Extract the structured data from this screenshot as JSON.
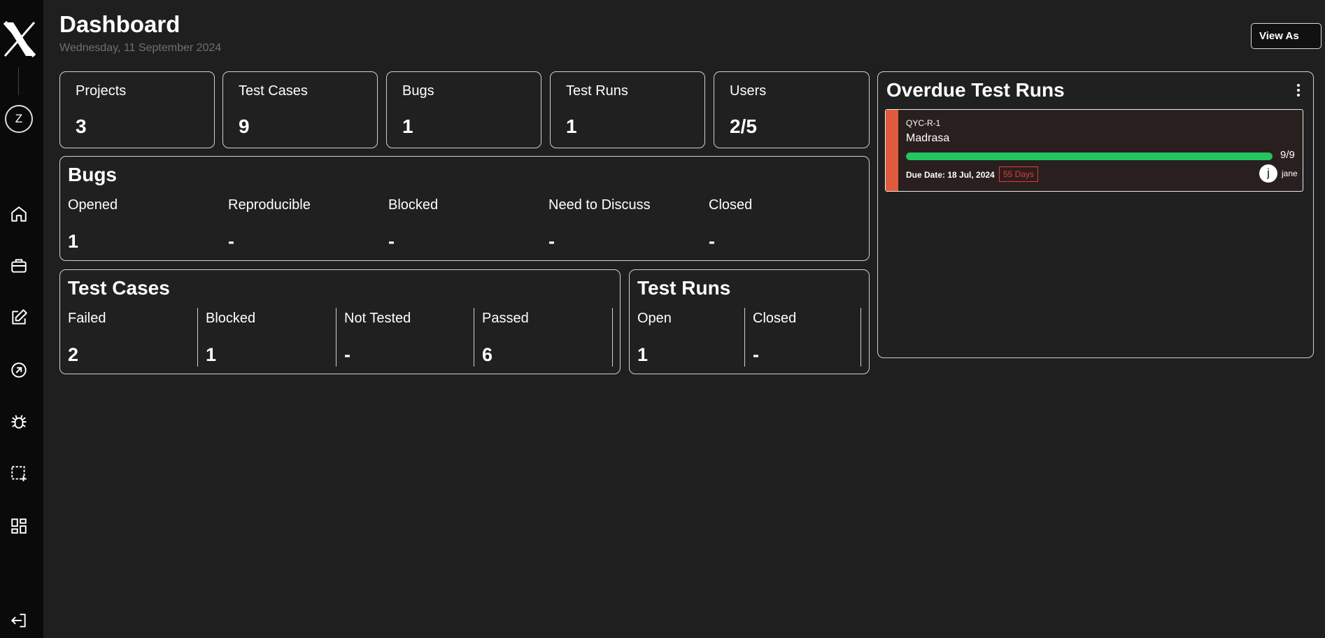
{
  "header": {
    "title": "Dashboard",
    "date": "Wednesday, 11 September 2024",
    "view_as_label": "View As"
  },
  "sidebar": {
    "avatar_initial": "Z",
    "icons": [
      "home-icon",
      "briefcase-icon",
      "edit-icon",
      "arrow-up-right-circle-icon",
      "bug-icon",
      "add-selection-icon",
      "dashboard-grid-icon",
      "logout-icon"
    ]
  },
  "stats": [
    {
      "label": "Projects",
      "value": "3"
    },
    {
      "label": "Test Cases",
      "value": "9"
    },
    {
      "label": "Bugs",
      "value": "1"
    },
    {
      "label": "Test Runs",
      "value": "1"
    },
    {
      "label": "Users",
      "value": "2/5"
    }
  ],
  "bugs": {
    "title": "Bugs",
    "columns": [
      {
        "label": "Opened",
        "value": "1"
      },
      {
        "label": "Reproducible",
        "value": "-"
      },
      {
        "label": "Blocked",
        "value": "-"
      },
      {
        "label": "Need to Discuss",
        "value": "-"
      },
      {
        "label": "Closed",
        "value": "-"
      }
    ]
  },
  "test_cases": {
    "title": "Test Cases",
    "columns": [
      {
        "label": "Failed",
        "value": "2"
      },
      {
        "label": "Blocked",
        "value": "1"
      },
      {
        "label": "Not Tested",
        "value": "-"
      },
      {
        "label": "Passed",
        "value": "6"
      }
    ]
  },
  "test_runs": {
    "title": "Test Runs",
    "columns": [
      {
        "label": "Open",
        "value": "1"
      },
      {
        "label": "Closed",
        "value": "-"
      }
    ]
  },
  "overdue": {
    "title": "Overdue Test Runs",
    "items": [
      {
        "code": "QYC-R-1",
        "name": "Madrasa",
        "progress_text": "9/9",
        "progress_fraction": 1.0,
        "due_date": "Due Date: 18 Jul, 2024",
        "overdue_badge": "55 Days",
        "assignee_initial": "j",
        "assignee_name": "jane"
      }
    ]
  },
  "colors": {
    "background": "#1f1f1f",
    "sidebar": "#0a0a0a",
    "progress": "#22c55e",
    "overdue_stripe": "#e05a3c",
    "overdue_badge": "#e53935"
  }
}
